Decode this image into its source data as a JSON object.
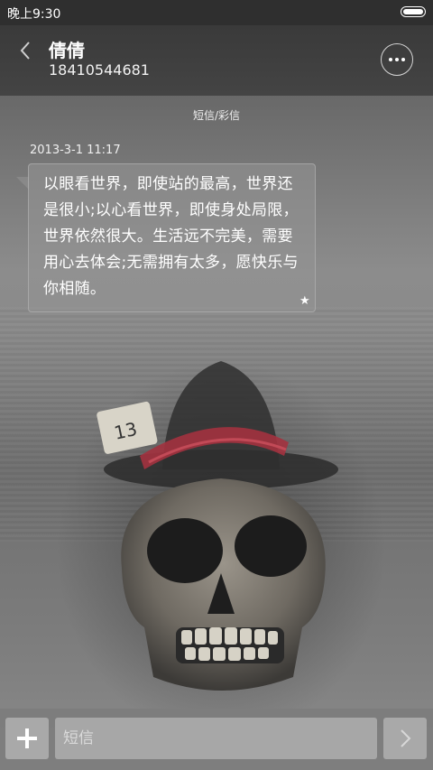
{
  "status_bar": {
    "time": "晚上9:30",
    "battery_icon": "battery-full-icon"
  },
  "header": {
    "back_icon": "chevron-left-icon",
    "contact_name": "倩倩",
    "contact_number": "18410544681",
    "more_icon": "more-dots-icon"
  },
  "conversation": {
    "type_label": "短信/彩信",
    "messages": [
      {
        "timestamp": "2013-3-1 11:17",
        "text": "以眼看世界，即使站的最高，世界还是很小;以心看世界，即使身处局限，世界依然很大。生活远不完美，需要用心去体会;无需拥有太多，愿快乐与你相随。",
        "starred_icon": "star-icon"
      }
    ]
  },
  "compose": {
    "add_icon": "plus-icon",
    "input_placeholder": "短信",
    "input_value": "",
    "send_icon": "chevron-right-icon"
  },
  "colors": {
    "header_bg": "#3a3a3a",
    "status_bg": "#2f2f2f",
    "bubble_bg": "#969696",
    "bottom_bar_bg": "#7d7d7d"
  }
}
